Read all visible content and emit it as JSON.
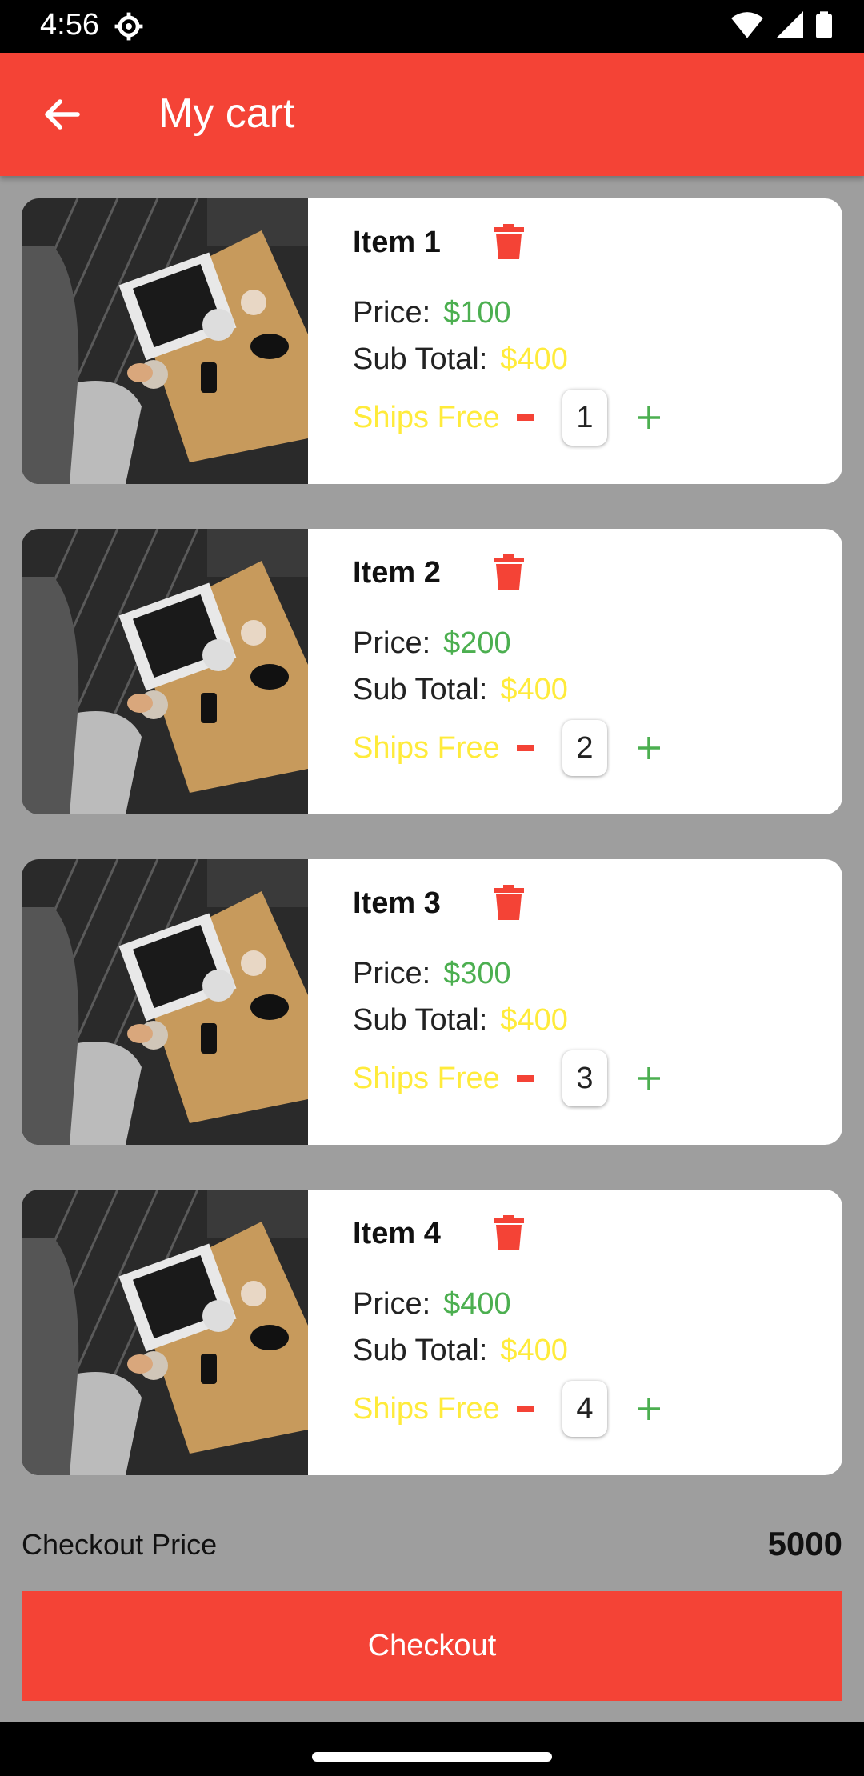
{
  "status_bar": {
    "time": "4:56"
  },
  "header": {
    "title": "My cart"
  },
  "cart": {
    "items": [
      {
        "name": "Item  1",
        "price_label": "Price:",
        "price": "$100",
        "subtotal_label": "Sub Total:",
        "subtotal": "$400",
        "shipping": "Ships Free",
        "quantity": "1"
      },
      {
        "name": "Item  2",
        "price_label": "Price:",
        "price": "$200",
        "subtotal_label": "Sub Total:",
        "subtotal": "$400",
        "shipping": "Ships Free",
        "quantity": "2"
      },
      {
        "name": "Item  3",
        "price_label": "Price:",
        "price": "$300",
        "subtotal_label": "Sub Total:",
        "subtotal": "$400",
        "shipping": "Ships Free",
        "quantity": "3"
      },
      {
        "name": "Item  4",
        "price_label": "Price:",
        "price": "$400",
        "subtotal_label": "Sub Total:",
        "subtotal": "$400",
        "shipping": "Ships Free",
        "quantity": "4"
      }
    ]
  },
  "footer": {
    "checkout_price_label": "Checkout Price",
    "checkout_total": "5000",
    "checkout_button": "Checkout"
  },
  "colors": {
    "accent": "#f44336",
    "price": "#4caf50",
    "subtotal": "#ffeb3b",
    "background": "#9e9e9e"
  },
  "icons": {
    "back": "arrow-left-icon",
    "delete": "trash-icon",
    "decrease": "minus-icon",
    "increase": "plus-icon"
  }
}
